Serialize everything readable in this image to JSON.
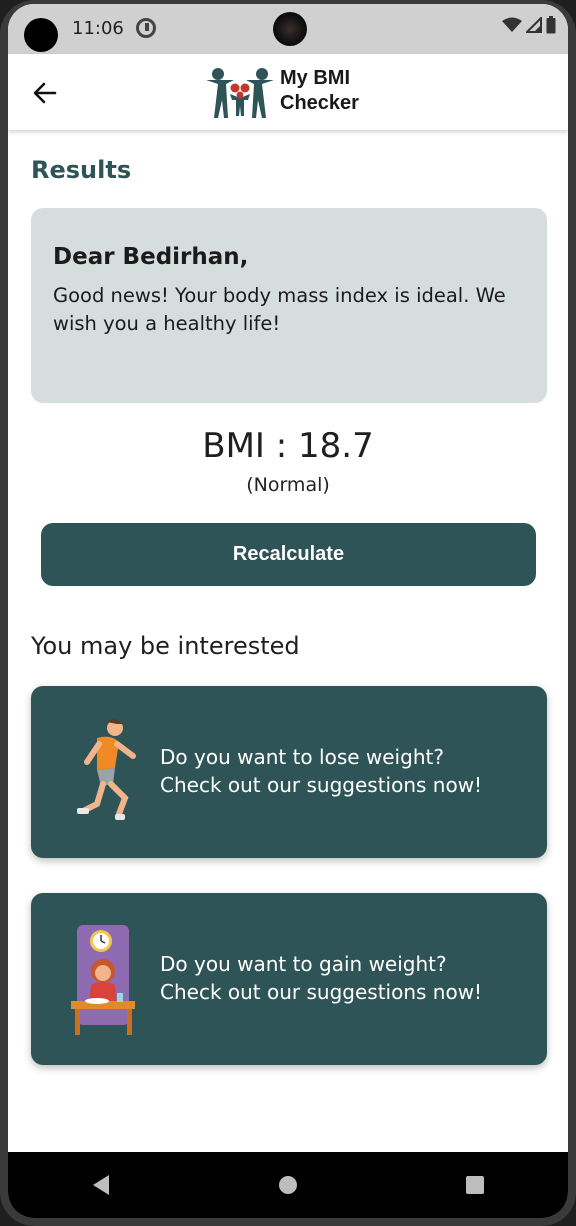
{
  "status_bar": {
    "time": "11:06"
  },
  "header": {
    "brand_name": "My BMI\nChecker"
  },
  "results": {
    "title": "Results",
    "greeting": "Dear Bedirhan,",
    "message": "Good news! Your body mass index is ideal. We wish you a healthy life!",
    "bmi_text": "BMI : 18.7",
    "category_text": "(Normal)"
  },
  "recalculate_label": "Recalculate",
  "suggestions": {
    "title": "You may be interested",
    "items": [
      {
        "line1": "Do you want to lose weight?",
        "line2": "Check out our suggestions now!",
        "illustration": "running-person-icon"
      },
      {
        "line1": "Do you want to gain weight?",
        "line2": "Check out our suggestions now!",
        "illustration": "eating-person-icon"
      }
    ]
  },
  "colors": {
    "primary": "#2e5457",
    "message_card": "#d6dedd",
    "status_bar": "#d0d0d0",
    "logo_teal": "#2e5457",
    "logo_red": "#c0392b"
  }
}
